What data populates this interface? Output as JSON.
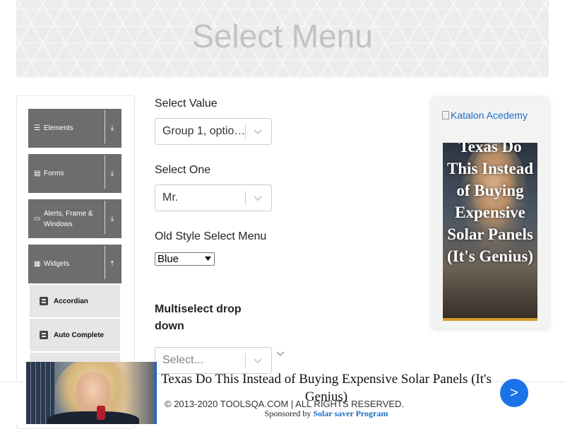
{
  "page": {
    "title": "Select Menu"
  },
  "sidebar": {
    "groups": [
      {
        "label": "Elements",
        "icon": "list-icon",
        "arrow": "download-icon"
      },
      {
        "label": "Forms",
        "icon": "form-icon",
        "arrow": "download-icon"
      },
      {
        "label": "Alerts, Frame & Windows",
        "icon": "window-icon",
        "arrow": "download-icon"
      },
      {
        "label": "Widgets",
        "icon": "grid-icon",
        "arrow": "upload-icon"
      }
    ],
    "widget_items": [
      {
        "label": "Accordian",
        "icon": "doc-icon"
      },
      {
        "label": "Auto Complete",
        "icon": "doc-icon"
      }
    ]
  },
  "form": {
    "select_value": {
      "label": "Select Value",
      "value": "Group 1, optio…"
    },
    "select_one": {
      "label": "Select One",
      "value": "Mr."
    },
    "old_style": {
      "label": "Old Style Select Menu",
      "value": "Blue"
    },
    "multiselect": {
      "label": "Multiselect drop down",
      "placeholder": "Select..."
    }
  },
  "ad": {
    "link_text": "Katalon Acedemy",
    "headline": "Texas Do This Instead of Buying Expensive Solar Panels (It's Genius)"
  },
  "footer": {
    "copyright": "© 2013-2020 TOOLSQA.COM | ALL RIGHTS RESERVED."
  },
  "bottom_ad": {
    "headline": "Texas Do This Instead of Buying Expensive Solar Panels (It's Genius)",
    "sponsored_by": "Sponsored by",
    "brand": "Solar saver Program",
    "go_label": ">"
  },
  "colors": {
    "sidebar_group": "#6d6d6d",
    "sub_item": "#e6e6e6",
    "link": "#1a6fc4",
    "go_button": "#1a73e8"
  }
}
